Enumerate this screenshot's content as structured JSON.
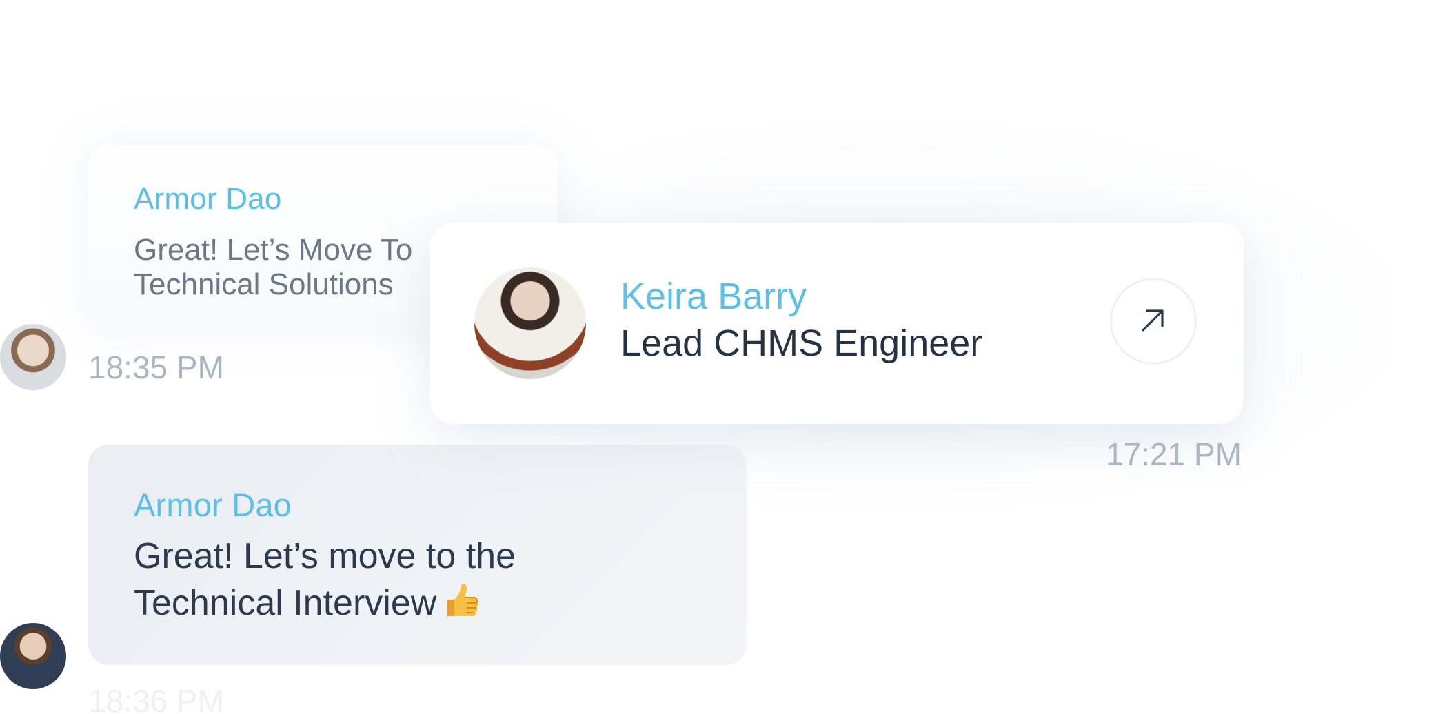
{
  "messages": [
    {
      "sender": "Armor Dao",
      "lines": [
        "Great! Let’s Move To",
        "Technical Solutions"
      ],
      "time": "18:35 PM"
    },
    {
      "sender": "Armor Dao",
      "lines": [
        "Great! Let’s move to the",
        "Technical Interview"
      ],
      "emoji": "thumbs-up-icon",
      "time": "18:36 PM"
    }
  ],
  "profile_card": {
    "name": "Keira Barry",
    "role": "Lead CHMS Engineer",
    "time": "17:21 PM",
    "action_icon": "arrow-up-right-icon"
  },
  "colors": {
    "accent": "#5bbfe7",
    "text": "#253244",
    "muted": "#a9b6c3",
    "bubble_bg": "#eaeef3"
  }
}
